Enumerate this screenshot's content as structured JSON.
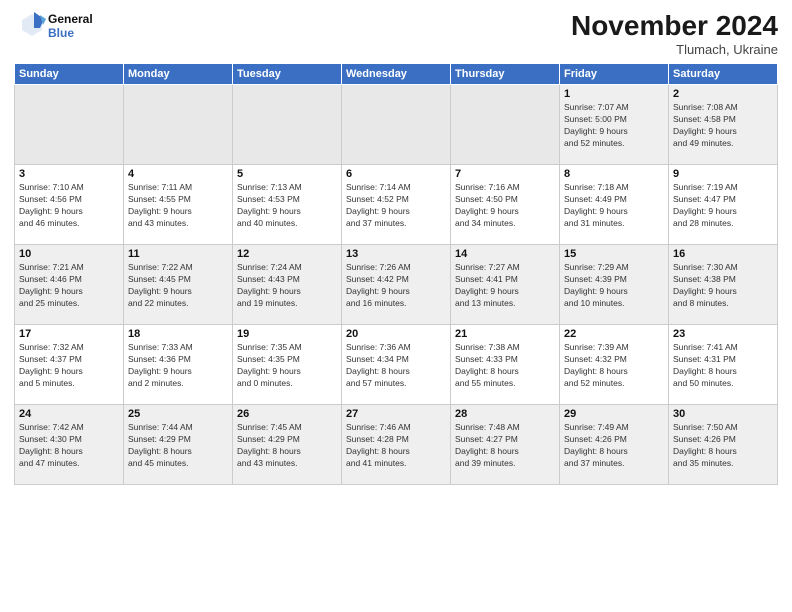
{
  "logo": {
    "line1": "General",
    "line2": "Blue"
  },
  "title": "November 2024",
  "subtitle": "Tlumach, Ukraine",
  "weekdays": [
    "Sunday",
    "Monday",
    "Tuesday",
    "Wednesday",
    "Thursday",
    "Friday",
    "Saturday"
  ],
  "weeks": [
    [
      {
        "day": "",
        "info": "",
        "empty": true
      },
      {
        "day": "",
        "info": "",
        "empty": true
      },
      {
        "day": "",
        "info": "",
        "empty": true
      },
      {
        "day": "",
        "info": "",
        "empty": true
      },
      {
        "day": "",
        "info": "",
        "empty": true
      },
      {
        "day": "1",
        "info": "Sunrise: 7:07 AM\nSunset: 5:00 PM\nDaylight: 9 hours\nand 52 minutes."
      },
      {
        "day": "2",
        "info": "Sunrise: 7:08 AM\nSunset: 4:58 PM\nDaylight: 9 hours\nand 49 minutes."
      }
    ],
    [
      {
        "day": "3",
        "info": "Sunrise: 7:10 AM\nSunset: 4:56 PM\nDaylight: 9 hours\nand 46 minutes."
      },
      {
        "day": "4",
        "info": "Sunrise: 7:11 AM\nSunset: 4:55 PM\nDaylight: 9 hours\nand 43 minutes."
      },
      {
        "day": "5",
        "info": "Sunrise: 7:13 AM\nSunset: 4:53 PM\nDaylight: 9 hours\nand 40 minutes."
      },
      {
        "day": "6",
        "info": "Sunrise: 7:14 AM\nSunset: 4:52 PM\nDaylight: 9 hours\nand 37 minutes."
      },
      {
        "day": "7",
        "info": "Sunrise: 7:16 AM\nSunset: 4:50 PM\nDaylight: 9 hours\nand 34 minutes."
      },
      {
        "day": "8",
        "info": "Sunrise: 7:18 AM\nSunset: 4:49 PM\nDaylight: 9 hours\nand 31 minutes."
      },
      {
        "day": "9",
        "info": "Sunrise: 7:19 AM\nSunset: 4:47 PM\nDaylight: 9 hours\nand 28 minutes."
      }
    ],
    [
      {
        "day": "10",
        "info": "Sunrise: 7:21 AM\nSunset: 4:46 PM\nDaylight: 9 hours\nand 25 minutes."
      },
      {
        "day": "11",
        "info": "Sunrise: 7:22 AM\nSunset: 4:45 PM\nDaylight: 9 hours\nand 22 minutes."
      },
      {
        "day": "12",
        "info": "Sunrise: 7:24 AM\nSunset: 4:43 PM\nDaylight: 9 hours\nand 19 minutes."
      },
      {
        "day": "13",
        "info": "Sunrise: 7:26 AM\nSunset: 4:42 PM\nDaylight: 9 hours\nand 16 minutes."
      },
      {
        "day": "14",
        "info": "Sunrise: 7:27 AM\nSunset: 4:41 PM\nDaylight: 9 hours\nand 13 minutes."
      },
      {
        "day": "15",
        "info": "Sunrise: 7:29 AM\nSunset: 4:39 PM\nDaylight: 9 hours\nand 10 minutes."
      },
      {
        "day": "16",
        "info": "Sunrise: 7:30 AM\nSunset: 4:38 PM\nDaylight: 9 hours\nand 8 minutes."
      }
    ],
    [
      {
        "day": "17",
        "info": "Sunrise: 7:32 AM\nSunset: 4:37 PM\nDaylight: 9 hours\nand 5 minutes."
      },
      {
        "day": "18",
        "info": "Sunrise: 7:33 AM\nSunset: 4:36 PM\nDaylight: 9 hours\nand 2 minutes."
      },
      {
        "day": "19",
        "info": "Sunrise: 7:35 AM\nSunset: 4:35 PM\nDaylight: 9 hours\nand 0 minutes."
      },
      {
        "day": "20",
        "info": "Sunrise: 7:36 AM\nSunset: 4:34 PM\nDaylight: 8 hours\nand 57 minutes."
      },
      {
        "day": "21",
        "info": "Sunrise: 7:38 AM\nSunset: 4:33 PM\nDaylight: 8 hours\nand 55 minutes."
      },
      {
        "day": "22",
        "info": "Sunrise: 7:39 AM\nSunset: 4:32 PM\nDaylight: 8 hours\nand 52 minutes."
      },
      {
        "day": "23",
        "info": "Sunrise: 7:41 AM\nSunset: 4:31 PM\nDaylight: 8 hours\nand 50 minutes."
      }
    ],
    [
      {
        "day": "24",
        "info": "Sunrise: 7:42 AM\nSunset: 4:30 PM\nDaylight: 8 hours\nand 47 minutes."
      },
      {
        "day": "25",
        "info": "Sunrise: 7:44 AM\nSunset: 4:29 PM\nDaylight: 8 hours\nand 45 minutes."
      },
      {
        "day": "26",
        "info": "Sunrise: 7:45 AM\nSunset: 4:29 PM\nDaylight: 8 hours\nand 43 minutes."
      },
      {
        "day": "27",
        "info": "Sunrise: 7:46 AM\nSunset: 4:28 PM\nDaylight: 8 hours\nand 41 minutes."
      },
      {
        "day": "28",
        "info": "Sunrise: 7:48 AM\nSunset: 4:27 PM\nDaylight: 8 hours\nand 39 minutes."
      },
      {
        "day": "29",
        "info": "Sunrise: 7:49 AM\nSunset: 4:26 PM\nDaylight: 8 hours\nand 37 minutes."
      },
      {
        "day": "30",
        "info": "Sunrise: 7:50 AM\nSunset: 4:26 PM\nDaylight: 8 hours\nand 35 minutes."
      }
    ]
  ]
}
